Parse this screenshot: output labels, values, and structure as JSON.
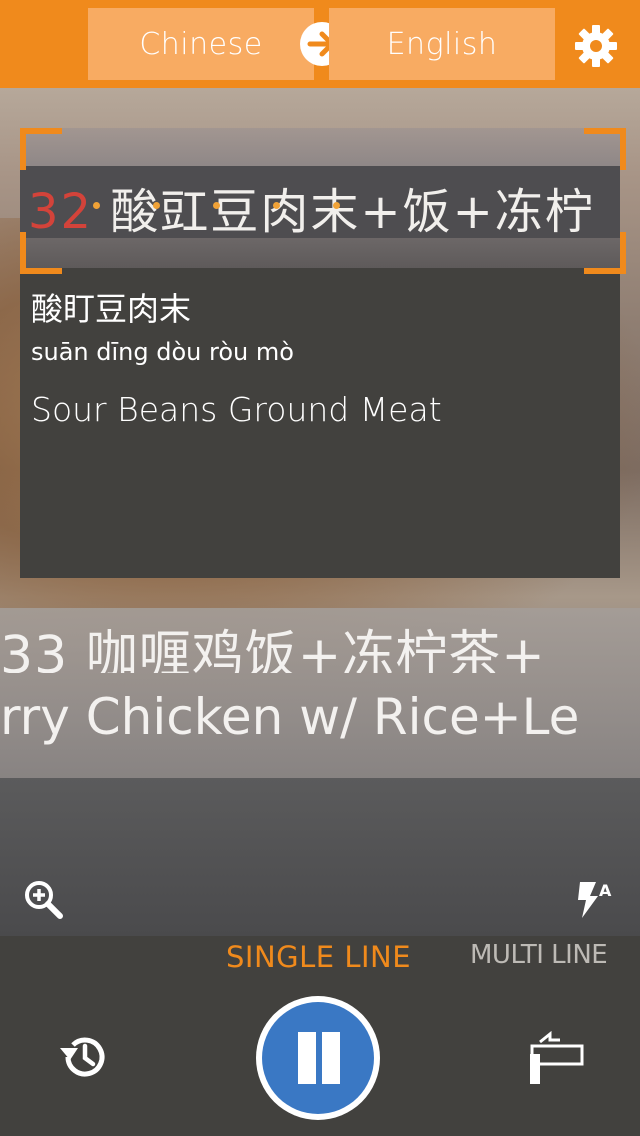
{
  "header": {
    "source_language": "Chinese",
    "target_language": "English",
    "swap_icon": "arrow-right-icon",
    "settings_icon": "gear-icon"
  },
  "camera": {
    "captured_line_prefix": "32",
    "captured_line_text": "酸豇豆肉末+饭+冻柠",
    "background_line1": "33 咖喱鸡饭+冻柠茶+",
    "background_line2": "rry Chicken w/ Rice+Le"
  },
  "result": {
    "source_text": "酸盯豆肉末",
    "pinyin": "suān dīng dòu ròu mò",
    "translation": "Sour Beans Ground Meat"
  },
  "controls": {
    "mode_single": "SINGLE LINE",
    "mode_multi": "MULTI LINE",
    "active_mode": "SINGLE LINE",
    "zoom_icon": "zoom-in-icon",
    "flash_icon": "auto-flash-icon",
    "history_icon": "history-icon",
    "pause_icon": "pause-icon",
    "keyboard_icon": "text-input-icon"
  },
  "colors": {
    "accent": "#f08a1c",
    "language_button": "#f8ab62",
    "panel": "#42413e",
    "pause_blue": "#3a78c4"
  }
}
